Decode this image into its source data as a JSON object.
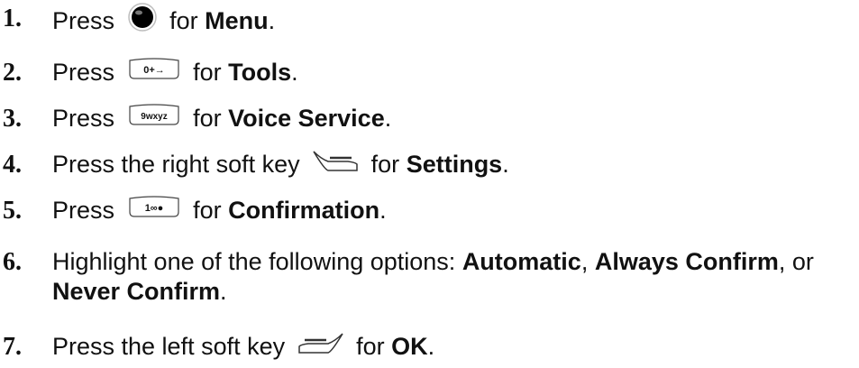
{
  "steps": [
    {
      "num": "1.",
      "pre": "Press",
      "icon": "center-dot-key-icon",
      "mid": "for",
      "bold": "Menu",
      "post": "."
    },
    {
      "num": "2.",
      "pre": "Press",
      "icon": "key-0-icon",
      "key_label": "0+→",
      "mid": "for",
      "bold": "Tools",
      "post": "."
    },
    {
      "num": "3.",
      "pre": "Press",
      "icon": "key-9-wxyz-icon",
      "key_label": "9wxyz",
      "mid": "for",
      "bold": "Voice Service",
      "post": "."
    },
    {
      "num": "4.",
      "pre": "Press the right soft key",
      "icon": "right-soft-key-icon",
      "mid": "for",
      "bold": "Settings",
      "post": "."
    },
    {
      "num": "5.",
      "pre": "Press",
      "icon": "key-1-icon",
      "key_label": "1∞●",
      "mid": "for",
      "bold": "Confirmation",
      "post": "."
    },
    {
      "num": "6.",
      "line1_pre": "Highlight one of the following options:",
      "opt1": "Automatic",
      "sep1": ",",
      "opt2": "Always Confirm",
      "sep2": ", or",
      "opt3": "Never Confirm",
      "post": "."
    },
    {
      "num": "7.",
      "pre": "Press the left soft key",
      "icon": "left-soft-key-icon",
      "mid": "for",
      "bold": "OK",
      "post": "."
    }
  ]
}
